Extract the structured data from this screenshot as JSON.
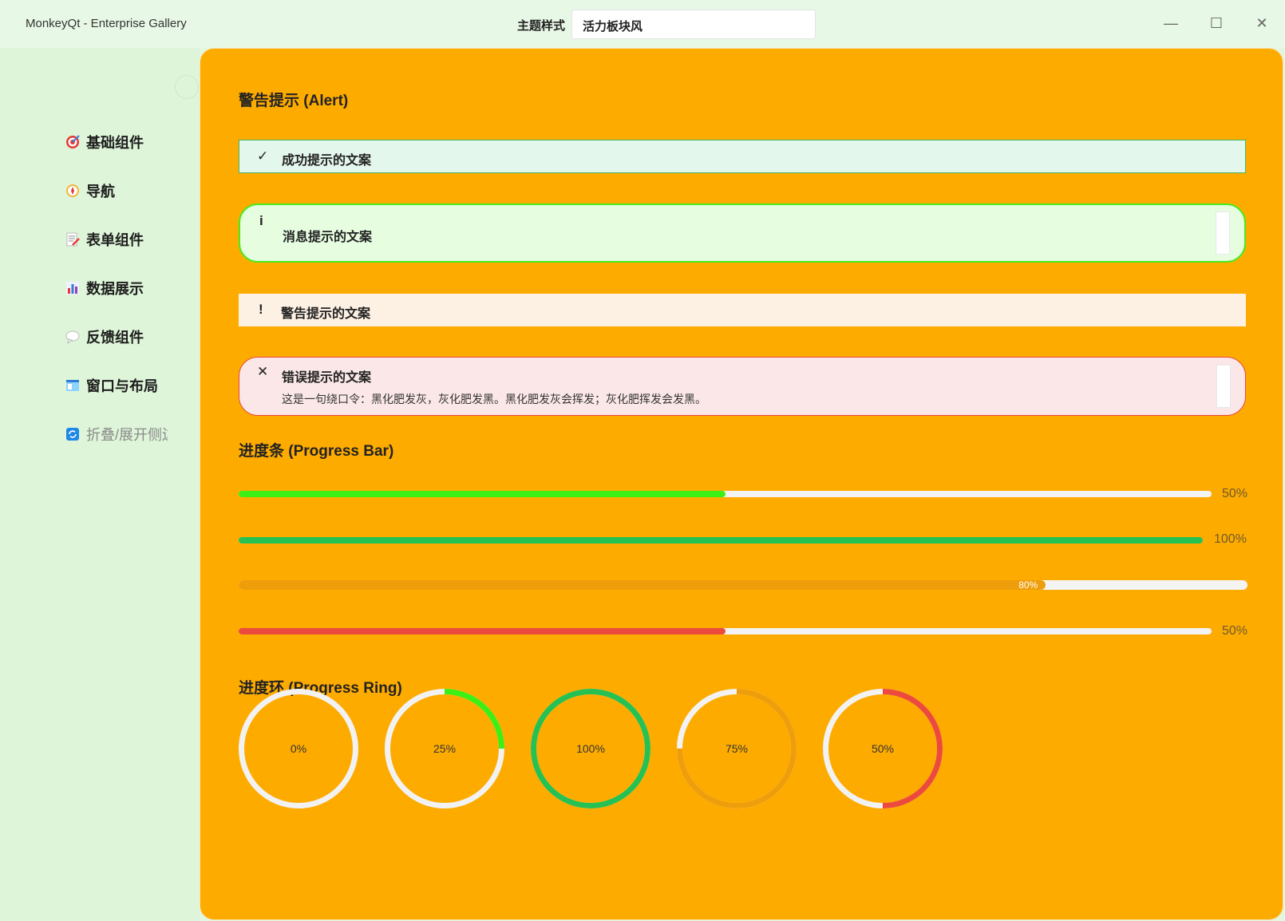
{
  "window": {
    "title": "MonkeyQt - Enterprise Gallery",
    "theme_label": "主题样式",
    "theme_value": "活力板块风",
    "minimize": "—",
    "maximize": "☐",
    "close": "✕"
  },
  "sidebar": {
    "items": [
      {
        "label": "基础组件",
        "icon": "target-icon"
      },
      {
        "label": "导航",
        "icon": "compass-icon"
      },
      {
        "label": "表单组件",
        "icon": "memo-icon"
      },
      {
        "label": "数据展示",
        "icon": "bar-chart-icon"
      },
      {
        "label": "反馈组件",
        "icon": "speech-bubble-icon"
      },
      {
        "label": "窗口与布局",
        "icon": "window-icon"
      },
      {
        "label": "折叠/展开侧边",
        "icon": "refresh-icon"
      }
    ]
  },
  "sections": {
    "alert_title": "警告提示 (Alert)",
    "progress_bar_title": "进度条 (Progress Bar)",
    "progress_ring_title": "进度环 (Progress Ring)"
  },
  "alerts": {
    "success": {
      "icon": "✓",
      "title": "成功提示的文案"
    },
    "info": {
      "icon": "i",
      "title": "消息提示的文案"
    },
    "warning": {
      "icon": "!",
      "title": "警告提示的文案"
    },
    "error": {
      "icon": "✕",
      "title": "错误提示的文案",
      "description": "这是一句绕口令：黑化肥发灰，灰化肥发黑。黑化肥发灰会挥发；灰化肥挥发会发黑。"
    }
  },
  "progress_bars": [
    {
      "value": 50,
      "label": "50%",
      "color": "#3cf015"
    },
    {
      "value": 100,
      "label": "100%",
      "color": "#26c152"
    },
    {
      "value": 80,
      "label": "80%",
      "color": "#ee9e0b",
      "inner_text": true
    },
    {
      "value": 50,
      "label": "50%",
      "color": "#ec4a3c"
    }
  ],
  "progress_rings": [
    {
      "value": 0,
      "label": "0%",
      "color": "#3cf015"
    },
    {
      "value": 25,
      "label": "25%",
      "color": "#3cf015"
    },
    {
      "value": 100,
      "label": "100%",
      "color": "#26c152"
    },
    {
      "value": 75,
      "label": "75%",
      "color": "#ee9e0b"
    },
    {
      "value": 50,
      "label": "50%",
      "color": "#ec4a3c"
    }
  ]
}
